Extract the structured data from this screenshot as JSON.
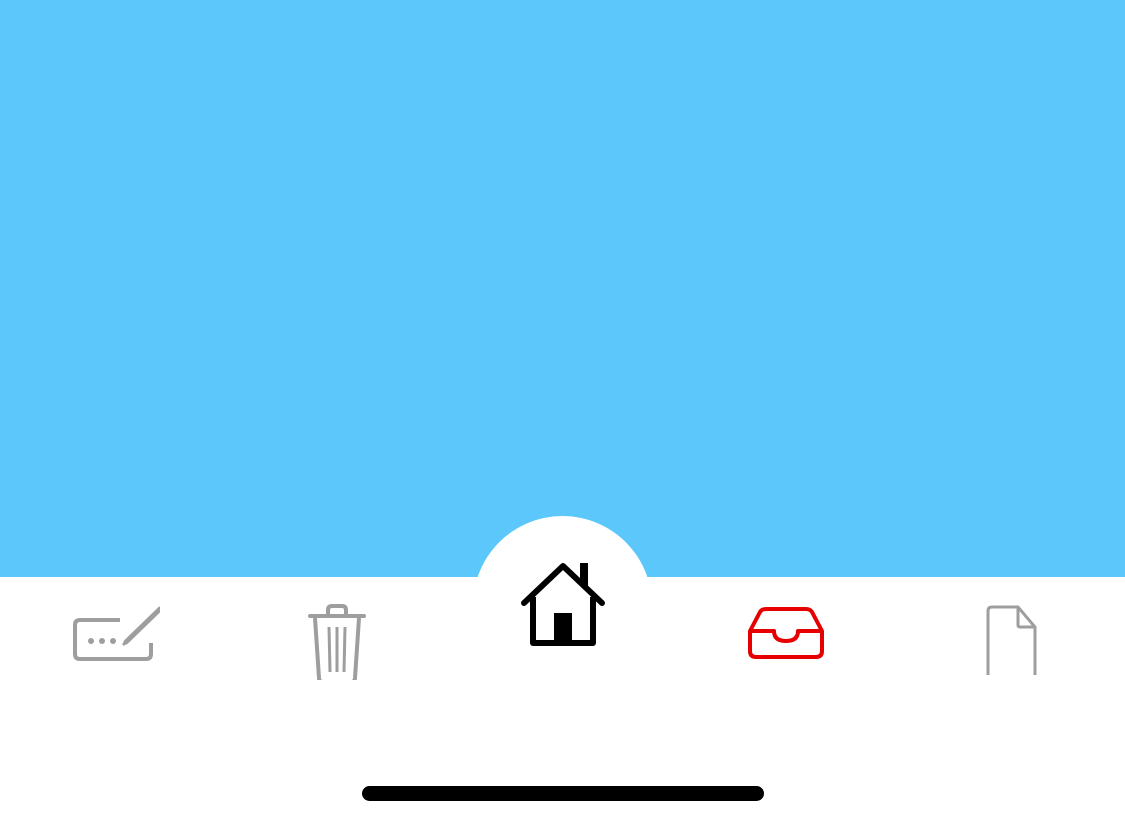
{
  "colors": {
    "background": "#5BC7FB",
    "tabbar": "#FFFFFF",
    "inactive_icon": "#9E9E9E",
    "selected_icon": "#E60000",
    "center_icon": "#000000",
    "home_indicator": "#000000"
  },
  "tabbar": {
    "items": [
      {
        "icon": "compose-icon",
        "state": "inactive"
      },
      {
        "icon": "trash-icon",
        "state": "inactive"
      },
      {
        "icon": "home-icon",
        "state": "center"
      },
      {
        "icon": "tray-icon",
        "state": "selected"
      },
      {
        "icon": "document-icon",
        "state": "inactive"
      }
    ]
  }
}
